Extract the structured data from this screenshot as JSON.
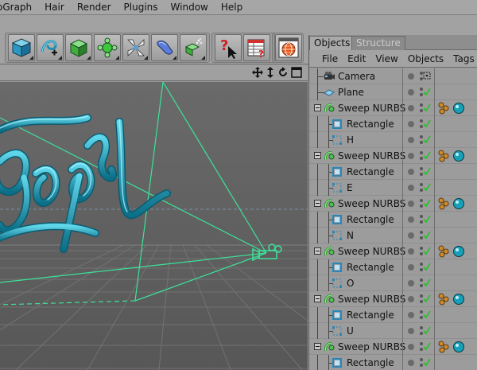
{
  "menu": {
    "items": [
      "oGraph",
      "Hair",
      "Render",
      "Plugins",
      "Window",
      "Help"
    ]
  },
  "toolbar": {
    "tools": [
      {
        "icon": "cube-icon"
      },
      {
        "icon": "spline-pen-icon"
      },
      {
        "icon": "nurbs-icon"
      },
      {
        "icon": "array-icon"
      },
      {
        "icon": "scene-icon"
      },
      {
        "icon": "deformer-icon"
      },
      {
        "icon": "environment-icon"
      },
      {
        "icon": "help-pointer-icon"
      },
      {
        "icon": "script-manager-icon"
      },
      {
        "icon": "render-globe-icon"
      }
    ]
  },
  "objects_manager": {
    "tabs": [
      "Objects",
      "Structure"
    ],
    "menu": [
      "File",
      "Edit",
      "View",
      "Objects",
      "Tags"
    ],
    "rows": [
      {
        "label": "Camera",
        "type": "camera"
      },
      {
        "label": "Plane",
        "type": "plane"
      },
      {
        "label": "Sweep NURBS",
        "type": "sweep"
      },
      {
        "label": "Rectangle",
        "type": "rectangle"
      },
      {
        "label": "H",
        "type": "spline"
      },
      {
        "label": "Sweep NURBS",
        "type": "sweep"
      },
      {
        "label": "Rectangle",
        "type": "rectangle"
      },
      {
        "label": "E",
        "type": "spline"
      },
      {
        "label": "Sweep NURBS",
        "type": "sweep"
      },
      {
        "label": "Rectangle",
        "type": "rectangle"
      },
      {
        "label": "N",
        "type": "spline"
      },
      {
        "label": "Sweep NURBS",
        "type": "sweep"
      },
      {
        "label": "Rectangle",
        "type": "rectangle"
      },
      {
        "label": "O",
        "type": "spline"
      },
      {
        "label": "Sweep NURBS",
        "type": "sweep"
      },
      {
        "label": "Rectangle",
        "type": "rectangle"
      },
      {
        "label": "U",
        "type": "spline"
      },
      {
        "label": "Sweep NURBS",
        "type": "sweep"
      },
      {
        "label": "Rectangle",
        "type": "rectangle"
      }
    ]
  },
  "colors": {
    "viewport_bg": "#5e5e5e",
    "grid": "#6e6e6e",
    "sweep_cyan": "#1aa6c0",
    "camera_green": "#39e89a",
    "check_green": "#22c222"
  }
}
